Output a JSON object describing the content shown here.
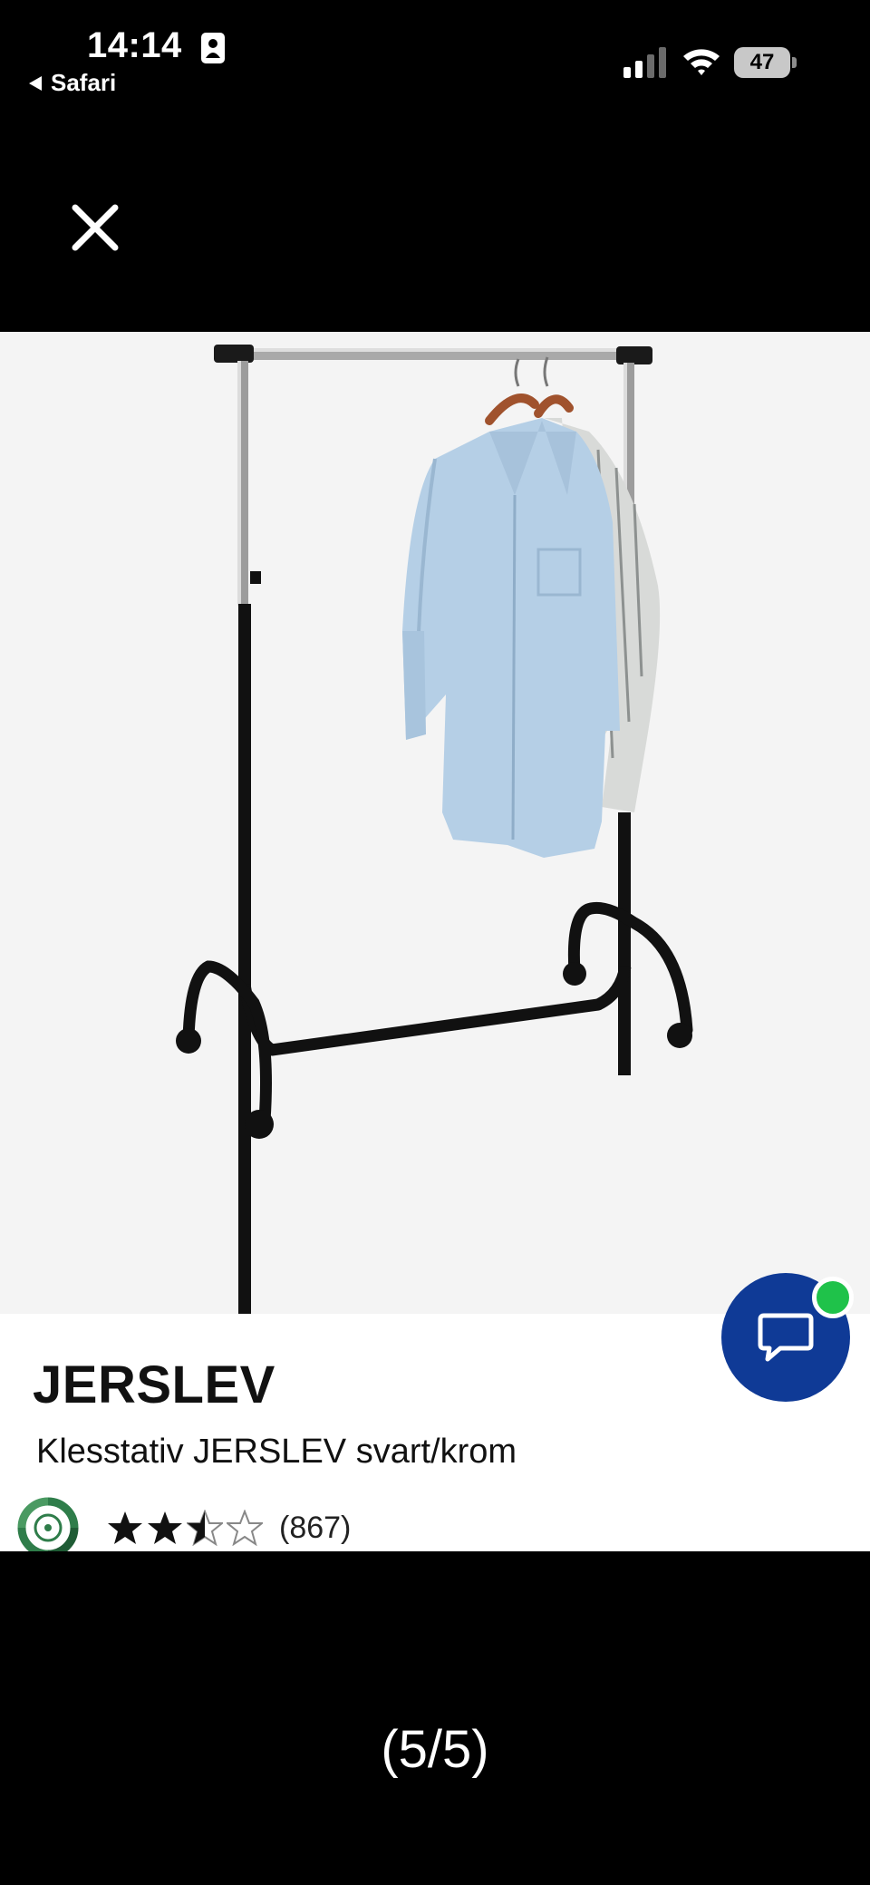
{
  "status_bar": {
    "time": "14:14",
    "back_label": "Safari",
    "battery_level": "47"
  },
  "product": {
    "brand": "JERSLEV",
    "description": "Klesstativ JERSLEV svart/krom",
    "rating_value": 2.5,
    "rating_max": 5,
    "review_count": "(867)",
    "image_subject": "clothes-rack-with-shirts"
  },
  "chat": {
    "icon": "speech-bubble-icon",
    "online": true,
    "accent_color": "#0f3a96",
    "online_color": "#1fc24a"
  },
  "pager": {
    "label": "(5/5)"
  }
}
